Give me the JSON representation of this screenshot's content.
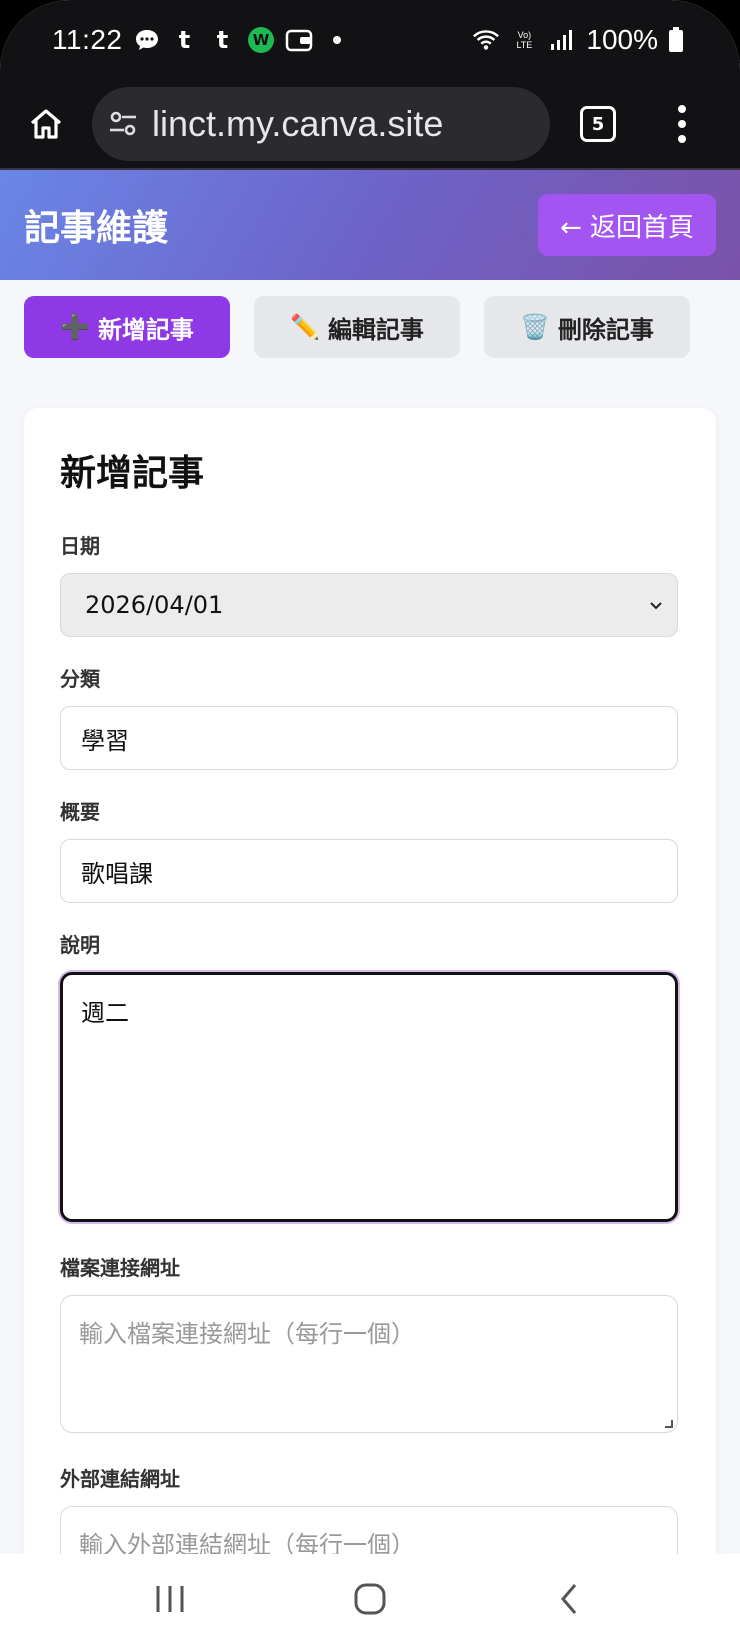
{
  "status_bar": {
    "time": "11:22",
    "battery": "100%",
    "notification_icons": [
      "chat-bubble-icon",
      "t-icon",
      "t-icon",
      "w-app-icon",
      "wallet-icon",
      "dot-icon"
    ],
    "system_icons": [
      "wifi-icon",
      "volte-icon",
      "signal-icon",
      "battery-icon"
    ]
  },
  "browser": {
    "url": "linct.my.canva.site",
    "tab_count": "5"
  },
  "header": {
    "title": "記事維護",
    "back_label": "← 返回首頁"
  },
  "actions": [
    {
      "icon": "➕",
      "label": "新增記事",
      "active": true
    },
    {
      "icon": "✏️",
      "label": "編輯記事",
      "active": false
    },
    {
      "icon": "🗑️",
      "label": "刪除記事",
      "active": false
    }
  ],
  "form": {
    "title": "新增記事",
    "date_label": "日期",
    "date_value": "2026/04/01",
    "category_label": "分類",
    "category_value": "學習",
    "summary_label": "概要",
    "summary_value": "歌唱課",
    "description_label": "說明",
    "description_value": "週二",
    "file_url_label": "檔案連接網址",
    "file_url_placeholder": "輸入檔案連接網址（每行一個）",
    "external_url_label": "外部連結網址",
    "external_url_placeholder": "輸入外部連結網址（每行一個）"
  },
  "colors": {
    "header_gradient_start": "#6a86e6",
    "header_gradient_end": "#7b52a8",
    "accent_purple": "#8e38e6",
    "back_button": "#a355f1"
  }
}
